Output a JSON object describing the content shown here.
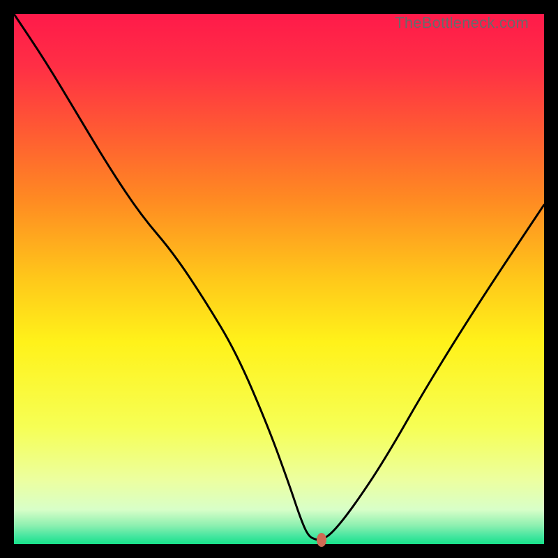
{
  "watermark": "TheBottleneck.com",
  "colors": {
    "frame_bg": "#000000",
    "gradient_stops": [
      {
        "offset": 0.0,
        "color": "#ff1a4a"
      },
      {
        "offset": 0.1,
        "color": "#ff2f45"
      },
      {
        "offset": 0.22,
        "color": "#ff5a33"
      },
      {
        "offset": 0.35,
        "color": "#ff8a22"
      },
      {
        "offset": 0.5,
        "color": "#ffc81a"
      },
      {
        "offset": 0.62,
        "color": "#fff21a"
      },
      {
        "offset": 0.78,
        "color": "#f6ff55"
      },
      {
        "offset": 0.88,
        "color": "#ecffa0"
      },
      {
        "offset": 0.935,
        "color": "#d8ffc8"
      },
      {
        "offset": 0.965,
        "color": "#8df0b0"
      },
      {
        "offset": 0.985,
        "color": "#46e6a0"
      },
      {
        "offset": 1.0,
        "color": "#17e28a"
      }
    ],
    "curve": "#000000",
    "marker": "#cf6a54"
  },
  "chart_data": {
    "type": "line",
    "title": "",
    "xlabel": "",
    "ylabel": "",
    "xlim": [
      0,
      100
    ],
    "ylim": [
      0,
      100
    ],
    "series": [
      {
        "name": "bottleneck-curve",
        "x": [
          0,
          6,
          12,
          18,
          24,
          30,
          36,
          42,
          48,
          52,
          54,
          55.5,
          57,
          58,
          60,
          64,
          70,
          78,
          88,
          100
        ],
        "y": [
          100,
          91,
          81,
          71,
          62,
          55,
          46,
          36,
          22,
          11,
          5,
          1.5,
          0.8,
          0.8,
          2,
          7,
          16,
          30,
          46,
          64
        ]
      }
    ],
    "marker": {
      "x": 58,
      "y": 0.8
    },
    "annotations": [
      {
        "text": "TheBottleneck.com",
        "role": "watermark",
        "position": "top-right"
      }
    ],
    "grid": false,
    "legend": false
  }
}
